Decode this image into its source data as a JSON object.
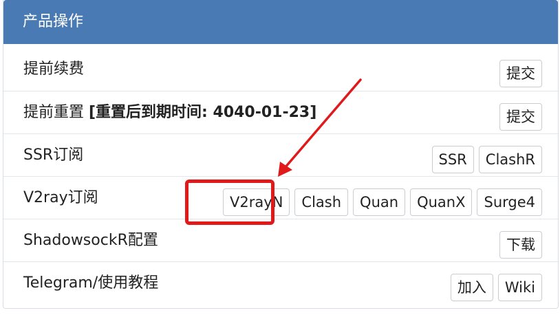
{
  "panel": {
    "title": "产品操作",
    "rows": [
      {
        "label": "提前续费",
        "buttons": [
          "提交"
        ]
      },
      {
        "label_prefix": "提前重置 ",
        "label_strong": "[重置后到期时间: 4040-01-23]",
        "buttons": [
          "提交"
        ]
      },
      {
        "label": "SSR订阅",
        "buttons": [
          "SSR",
          "ClashR"
        ]
      },
      {
        "label": "V2ray订阅",
        "buttons": [
          "V2rayN",
          "Clash",
          "Quan",
          "QuanX",
          "Surge4"
        ]
      },
      {
        "label": "ShadowsockR配置",
        "buttons": [
          "下载"
        ]
      },
      {
        "label": "Telegram/使用教程",
        "buttons": [
          "加入",
          "Wiki"
        ]
      }
    ]
  },
  "annotation": {
    "color": "#e01a1a",
    "highlighted_button": "V2rayN"
  },
  "colors": {
    "header_bg": "#4a7ab3"
  }
}
